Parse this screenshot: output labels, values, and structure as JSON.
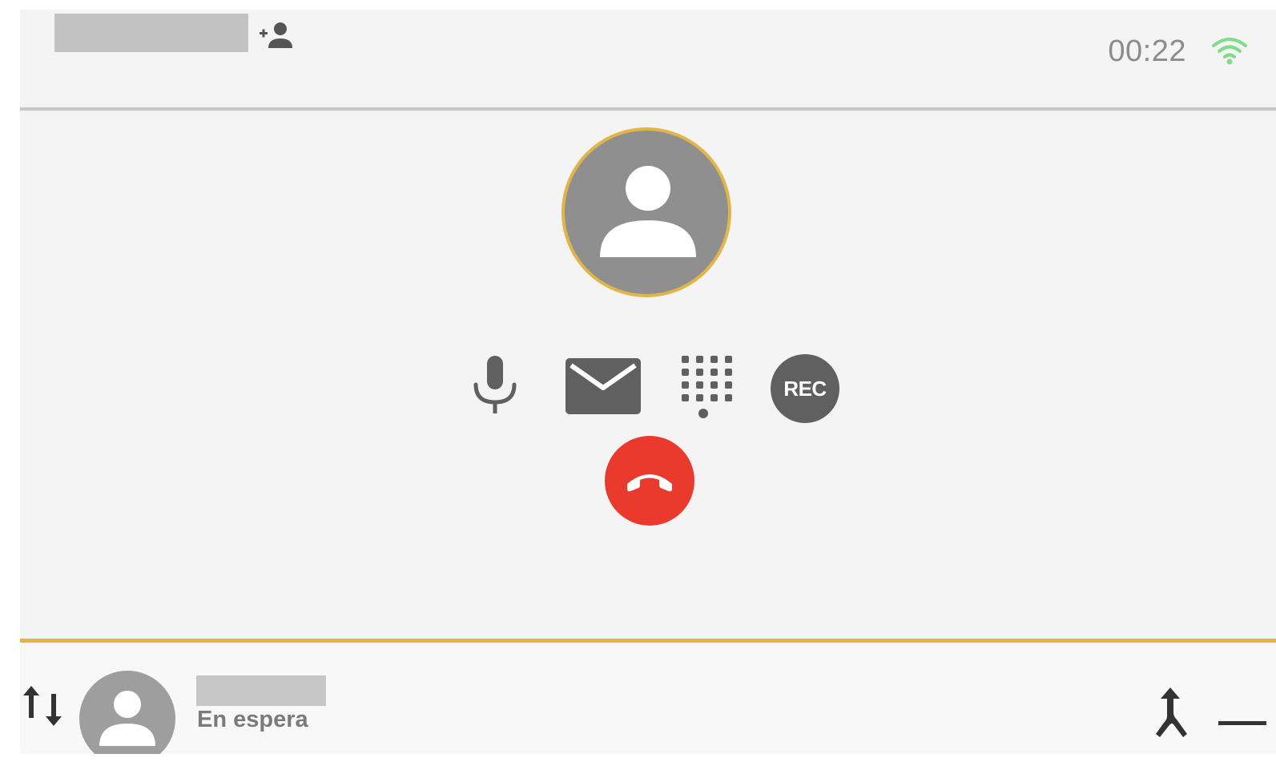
{
  "header": {
    "timer": "00:22"
  },
  "controls": {
    "record_label": "REC"
  },
  "held_call": {
    "status": "En espera"
  },
  "colors": {
    "background": "#f4f4f4",
    "accent_gold": "#e9b23e",
    "end_call_red": "#ea3a2e",
    "signal_green": "#7fdc88",
    "icon_gray": "#606060"
  },
  "icons": [
    "add-person-icon",
    "wifi-signal-icon",
    "avatar-icon",
    "microphone-icon",
    "envelope-icon",
    "dialpad-icon",
    "record-icon",
    "end-call-icon",
    "swap-calls-icon",
    "merge-call-icon",
    "minimize-icon"
  ]
}
